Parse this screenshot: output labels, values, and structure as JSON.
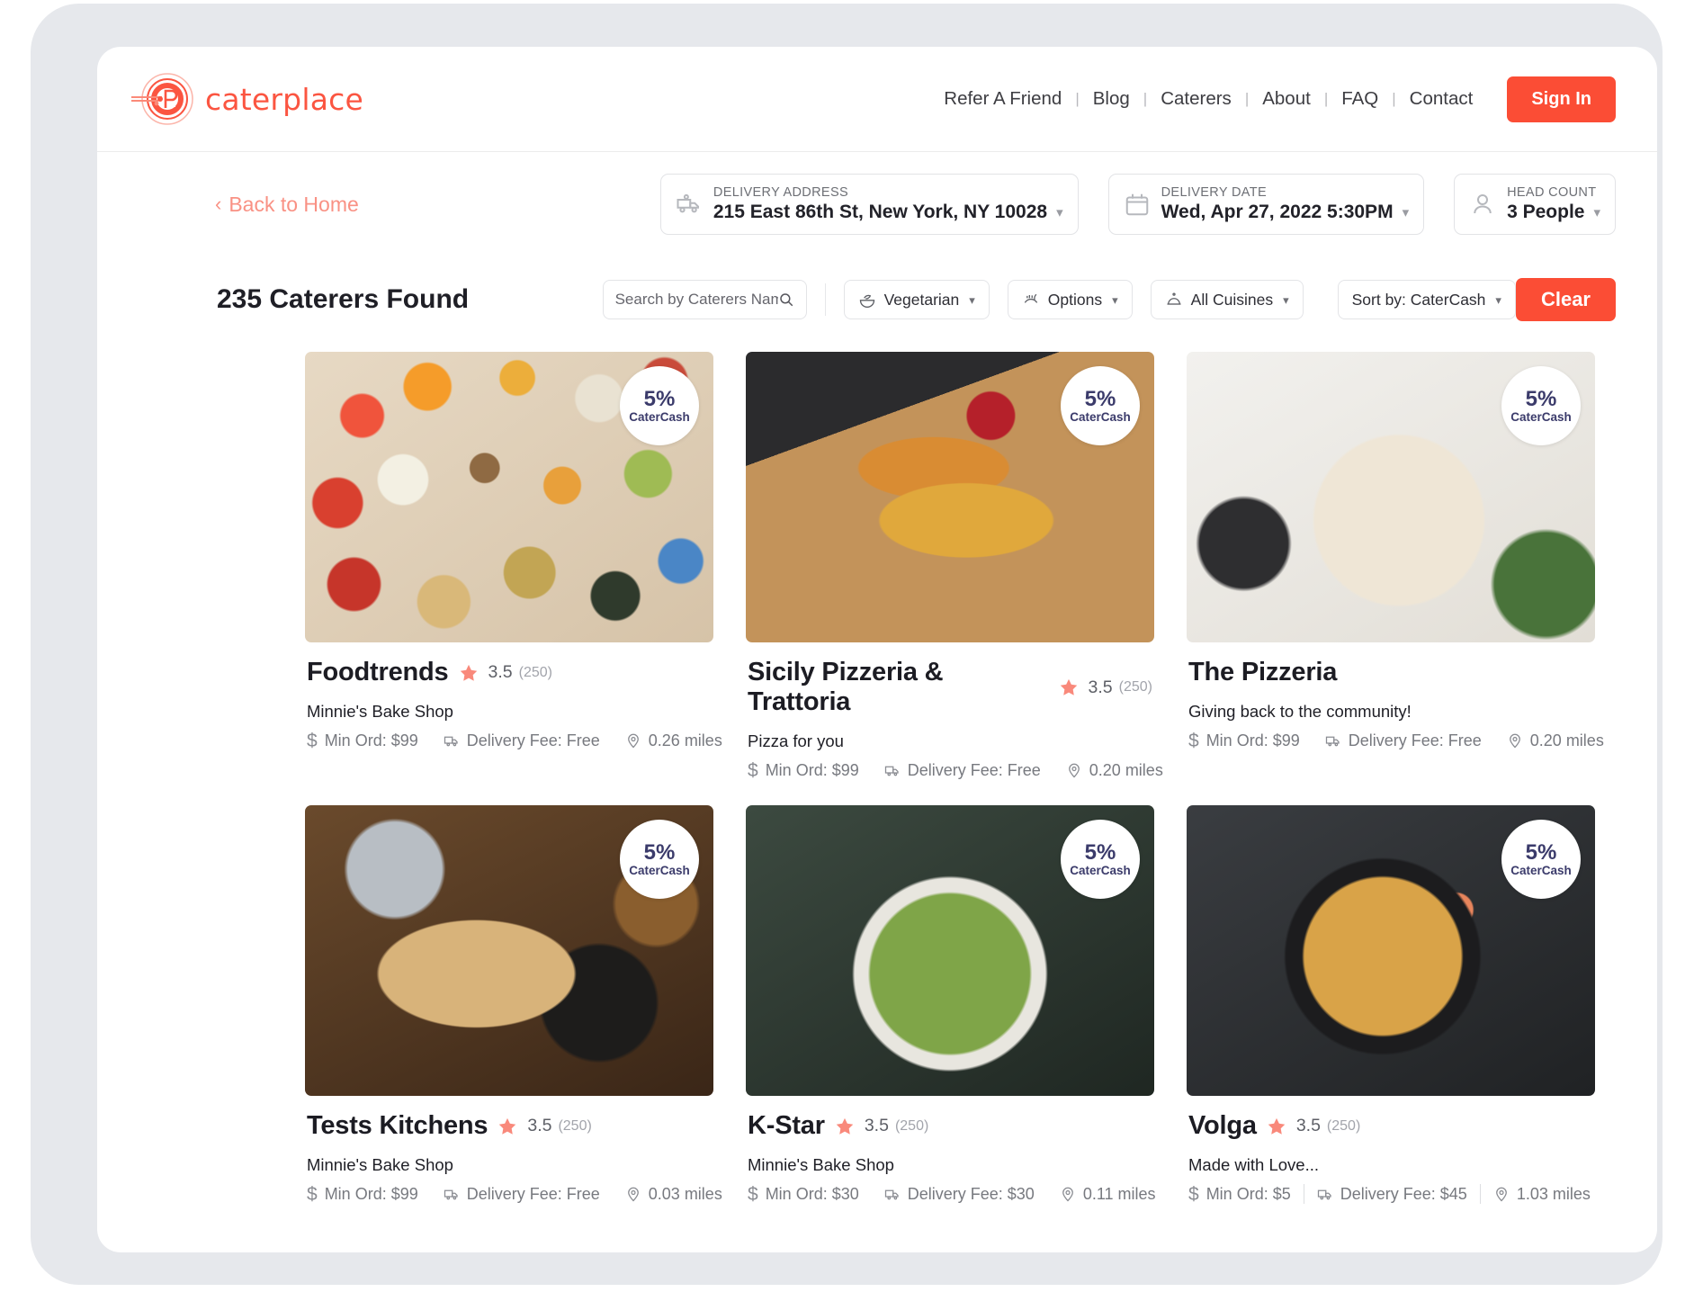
{
  "header": {
    "brand": "caterplace",
    "brand_color": "#fb5541",
    "nav": [
      {
        "label": "Refer A Friend"
      },
      {
        "label": "Blog"
      },
      {
        "label": "Caterers"
      },
      {
        "label": "About"
      },
      {
        "label": "FAQ"
      },
      {
        "label": "Contact"
      }
    ],
    "nav_separator": "|",
    "sign_in": "Sign In",
    "accent_color": "#fb4d35"
  },
  "context": {
    "back_link": "Back to Home",
    "back_chevron": "‹",
    "delivery_address": {
      "label": "DELIVERY ADDRESS",
      "value": "215 East 86th St, New York, NY 10028",
      "icon": "delivery-truck-icon"
    },
    "delivery_date": {
      "label": "DELIVERY DATE",
      "value": "Wed, Apr 27, 2022  5:30PM",
      "icon": "calendar-icon"
    },
    "head_count": {
      "label": "HEAD COUNT",
      "value": "3 People",
      "icon": "person-icon"
    }
  },
  "filters": {
    "results_count": "235 Caterers Found",
    "search_placeholder": "Search by Caterers Name",
    "search_value": "",
    "pills": [
      {
        "label": "Vegetarian",
        "icon": "vegetarian-bowl-icon"
      },
      {
        "label": "Options",
        "icon": "options-utensils-icon"
      },
      {
        "label": "All Cuisines",
        "icon": "cloche-icon"
      }
    ],
    "sort_label": "Sort by: CaterCash",
    "clear_label": "Clear"
  },
  "cards": [
    {
      "name": "Foodtrends",
      "rating": "3.5",
      "review_count": "(250)",
      "has_rating": true,
      "subtitle": "Minnie's Bake Shop",
      "min_order": "Min Ord: $99",
      "delivery_fee": "Delivery Fee: Free",
      "distance": "0.26 miles",
      "badge_pct": "5%",
      "badge_caption": "CaterCash",
      "photo": "ph-platter"
    },
    {
      "name": "Sicily Pizzeria & Trattoria",
      "rating": "3.5",
      "review_count": "(250)",
      "has_rating": true,
      "subtitle": "Pizza for you",
      "min_order": "Min Ord: $99",
      "delivery_fee": "Delivery Fee: Free",
      "distance": "0.20 miles",
      "badge_pct": "5%",
      "badge_caption": "CaterCash",
      "photo": "ph-pizza-board"
    },
    {
      "name": "The Pizzeria",
      "rating": "",
      "review_count": "",
      "has_rating": false,
      "subtitle": "Giving back to the community!",
      "min_order": "Min Ord: $99",
      "delivery_fee": "Delivery Fee: Free",
      "distance": "0.20 miles",
      "badge_pct": "5%",
      "badge_caption": "CaterCash",
      "photo": "ph-pizza-white"
    },
    {
      "name": "Tests Kitchens",
      "rating": "3.5",
      "review_count": "(250)",
      "has_rating": true,
      "subtitle": "Minnie's Bake Shop",
      "min_order": "Min Ord: $99",
      "delivery_fee": "Delivery Fee: Free",
      "distance": "0.03 miles",
      "badge_pct": "5%",
      "badge_caption": "CaterCash",
      "photo": "ph-seafood"
    },
    {
      "name": "K-Star",
      "rating": "3.5",
      "review_count": "(250)",
      "has_rating": true,
      "subtitle": "Minnie's Bake Shop",
      "min_order": "Min Ord: $30",
      "delivery_fee": "Delivery Fee: $30",
      "distance": "0.11 miles",
      "badge_pct": "5%",
      "badge_caption": "CaterCash",
      "photo": "ph-greenbowl"
    },
    {
      "name": "Volga",
      "rating": "3.5",
      "review_count": "(250)",
      "has_rating": true,
      "subtitle": "Made with Love...",
      "min_order": "Min Ord: $5",
      "delivery_fee": "Delivery Fee: $45",
      "distance": "1.03 miles",
      "badge_pct": "5%",
      "badge_caption": "CaterCash",
      "photo": "ph-pasta"
    }
  ],
  "meta_currency_symbol": "$"
}
